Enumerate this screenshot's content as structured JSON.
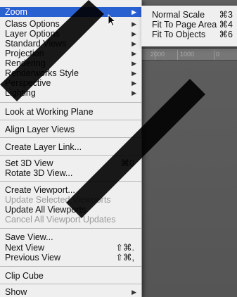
{
  "menu": {
    "items": [
      {
        "label": "Zoom",
        "arrow": "▶"
      },
      {
        "label": "Class Options",
        "arrow": "▶"
      },
      {
        "label": "Layer Options",
        "arrow": "▶"
      },
      {
        "label": "Standard Views",
        "arrow": "▶"
      },
      {
        "label": "Projection",
        "arrow": "▶"
      },
      {
        "label": "Rendering",
        "arrow": "▶"
      },
      {
        "label": "Renderworks Style",
        "arrow": "▶"
      },
      {
        "label": "Perspective",
        "arrow": "▶"
      },
      {
        "label": "Lighting",
        "arrow": "▶"
      },
      {
        "label": "Look at Working Plane"
      },
      {
        "label": "Align Layer Views"
      },
      {
        "label": "Create Layer Link..."
      },
      {
        "label": "Set 3D View",
        "shortcut": "⌘0"
      },
      {
        "label": "Rotate 3D View..."
      },
      {
        "label": "Create Viewport..."
      },
      {
        "label": "Update Selected Viewports"
      },
      {
        "label": "Update All Viewports"
      },
      {
        "label": "Cancel All Viewport Updates"
      },
      {
        "label": "Save View..."
      },
      {
        "label": "Next View",
        "shortcut": "⇧⌘."
      },
      {
        "label": "Previous View",
        "shortcut": "⇧⌘,"
      },
      {
        "label": "Clip Cube"
      },
      {
        "label": "Show",
        "arrow": "▶"
      }
    ]
  },
  "submenu": {
    "items": [
      {
        "label": "Normal Scale",
        "shortcut": "⌘3"
      },
      {
        "label": "Fit To Page Area",
        "shortcut": "⌘4"
      },
      {
        "label": "Fit To Objects",
        "shortcut": "⌘6"
      }
    ]
  },
  "ruler": {
    "labels": [
      "2000",
      "1000",
      "0"
    ]
  },
  "colors": {
    "highlight": "#2a61d0",
    "menu_bg": "#efefef",
    "disabled_text": "#9a9a9a",
    "overlay_slash": "#000000"
  }
}
